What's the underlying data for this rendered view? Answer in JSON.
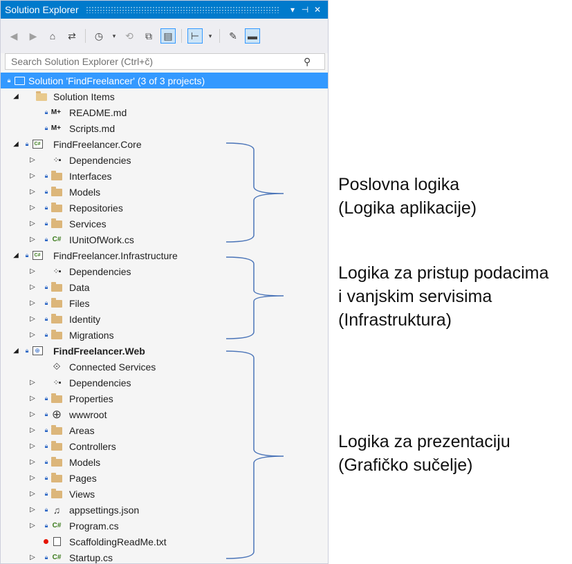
{
  "window": {
    "title": "Solution Explorer",
    "buttons": {
      "dropdown": "▾",
      "pin": "⊣",
      "close": "✕"
    }
  },
  "toolbar": {
    "icons": [
      "back-icon",
      "forward-icon",
      "home-icon",
      "switch-views-icon",
      "pending-changes-icon",
      "sync-icon",
      "collapse-all-icon",
      "show-all-files-icon",
      "preview-selected-icon",
      "properties-icon",
      "active-document-icon"
    ]
  },
  "search": {
    "placeholder": "Search Solution Explorer (Ctrl+č)",
    "icon": "⚲"
  },
  "tree": {
    "solution": "Solution 'FindFreelancer' (3 of 3 projects)",
    "solution_items": "Solution Items",
    "readme": "README.md",
    "scripts": "Scripts.md",
    "md_badge": "M+",
    "core": "FindFreelancer.Core",
    "core_items": [
      "Dependencies",
      "Interfaces",
      "Models",
      "Repositories",
      "Services",
      "IUnitOfWork.cs"
    ],
    "infra": "FindFreelancer.Infrastructure",
    "infra_items": [
      "Dependencies",
      "Data",
      "Files",
      "Identity",
      "Migrations"
    ],
    "web": "FindFreelancer.Web",
    "web_items": [
      "Connected Services",
      "Dependencies",
      "Properties",
      "wwwroot",
      "Areas",
      "Controllers",
      "Models",
      "Pages",
      "Views",
      "appsettings.json",
      "Program.cs",
      "ScaffoldingReadMe.txt",
      "Startup.cs"
    ],
    "cs_badge": "C#"
  },
  "annotations": {
    "business": [
      "Poslovna logika",
      "(Logika aplikacije)"
    ],
    "data": [
      "Logika za pristup podacima",
      "i vanjskim servisima",
      "(Infrastruktura)"
    ],
    "presentation": [
      "Logika za prezentaciju",
      "(Grafičko sučelje)"
    ]
  },
  "colors": {
    "accent": "#007acc",
    "selection": "#3399ff",
    "bracket": "#4a74b8",
    "folder": "#dcb67a"
  }
}
